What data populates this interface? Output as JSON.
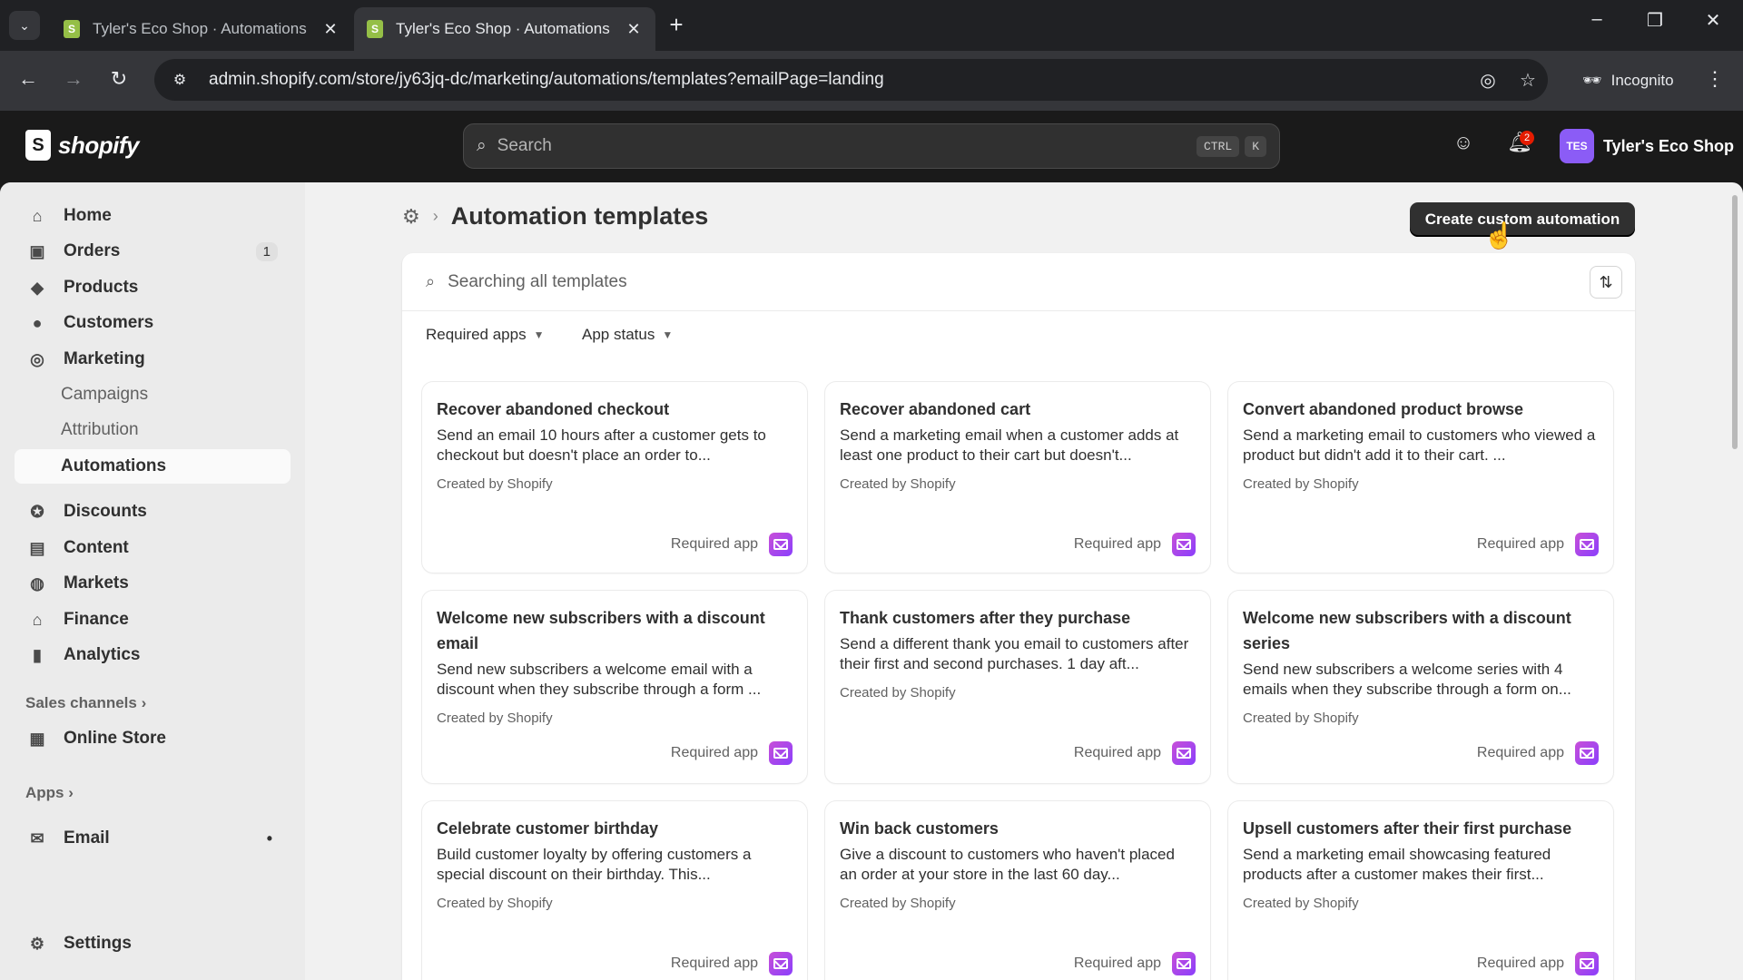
{
  "browser": {
    "tabs": [
      {
        "title": "Tyler's Eco Shop · Automations",
        "active": false
      },
      {
        "title": "Tyler's Eco Shop · Automations",
        "active": true
      }
    ],
    "new_tab_label": "+",
    "url": "admin.shopify.com/store/jy63jq-dc/marketing/automations/templates?emailPage=landing",
    "incognito_label": "Incognito"
  },
  "topbar": {
    "logo_text": "shopify",
    "search_placeholder": "Search",
    "shortcut_keys": [
      "CTRL",
      "K"
    ],
    "notification_count": "2",
    "store_initials": "TES",
    "store_name": "Tyler's Eco Shop"
  },
  "sidebar": {
    "items": [
      {
        "label": "Home",
        "icon": "home-icon"
      },
      {
        "label": "Orders",
        "icon": "orders-icon",
        "count": "1"
      },
      {
        "label": "Products",
        "icon": "tag-icon"
      },
      {
        "label": "Customers",
        "icon": "person-icon"
      },
      {
        "label": "Marketing",
        "icon": "target-icon"
      }
    ],
    "marketing_sub": [
      "Campaigns",
      "Attribution",
      "Automations"
    ],
    "items2": [
      {
        "label": "Discounts",
        "icon": "discount-icon"
      },
      {
        "label": "Content",
        "icon": "content-icon"
      },
      {
        "label": "Markets",
        "icon": "globe-icon"
      },
      {
        "label": "Finance",
        "icon": "bank-icon"
      },
      {
        "label": "Analytics",
        "icon": "bar-chart-icon"
      }
    ],
    "sales_channels_label": "Sales channels",
    "online_store_label": "Online Store",
    "apps_label": "Apps",
    "email_label": "Email",
    "settings_label": "Settings"
  },
  "main": {
    "page_title": "Automation templates",
    "create_button": "Create custom automation",
    "search_placeholder": "Searching all templates",
    "filters": [
      "Required apps",
      "App status"
    ],
    "templates": [
      {
        "title": "Recover abandoned checkout",
        "desc": "Send an email 10 hours after a customer gets to checkout but doesn't place an order to...",
        "by": "Created by Shopify",
        "req": "Required app"
      },
      {
        "title": "Recover abandoned cart",
        "desc": "Send a marketing email when a customer adds at least one product to their cart but doesn't...",
        "by": "Created by Shopify",
        "req": "Required app"
      },
      {
        "title": "Convert abandoned product browse",
        "desc": "Send a marketing email to customers who viewed a product but didn't add it to their cart. ...",
        "by": "Created by Shopify",
        "req": "Required app"
      },
      {
        "title": "Welcome new subscribers with a discount email",
        "desc": "Send new subscribers a welcome email with a discount when they subscribe through a form ...",
        "by": "Created by Shopify",
        "req": "Required app"
      },
      {
        "title": "Thank customers after they purchase",
        "desc": "Send a different thank you email to customers after their first and second purchases. 1 day aft...",
        "by": "Created by Shopify",
        "req": "Required app"
      },
      {
        "title": "Welcome new subscribers with a discount series",
        "desc": "Send new subscribers a welcome series with 4 emails when they subscribe through a form on...",
        "by": "Created by Shopify",
        "req": "Required app"
      },
      {
        "title": "Celebrate customer birthday",
        "desc": "Build customer loyalty by offering customers a special discount on their birthday. This...",
        "by": "Created by Shopify",
        "req": "Required app"
      },
      {
        "title": "Win back customers",
        "desc": "Give a discount to customers who haven't placed an order at your store in the last 60 day...",
        "by": "Created by Shopify",
        "req": "Required app"
      },
      {
        "title": "Upsell customers after their first purchase",
        "desc": "Send a marketing email showcasing featured products after a customer makes their first...",
        "by": "Created by Shopify",
        "req": "Required app"
      }
    ]
  }
}
